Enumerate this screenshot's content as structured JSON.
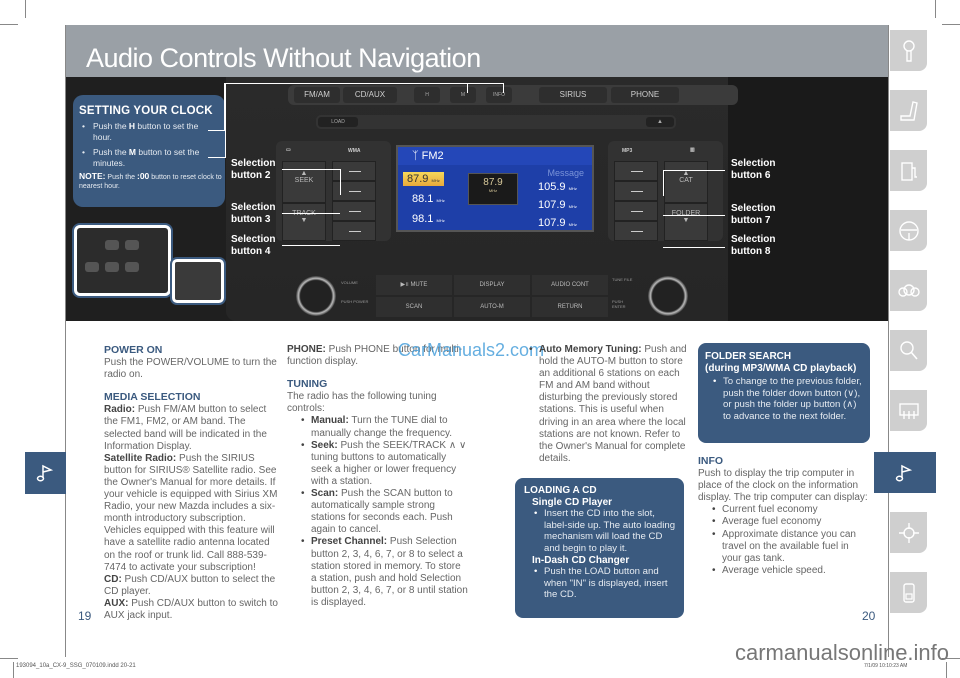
{
  "header": {
    "title": "Audio Controls Without Navigation"
  },
  "radio": {
    "top_buttons": [
      "FM/AM",
      "CD/AUX",
      "H",
      "M",
      "INFO",
      "SIRIUS",
      "PHONE"
    ],
    "load_label": "LOAD",
    "eject_label": "▲",
    "left_panel_labels": [
      "WMA"
    ],
    "right_panel_labels": [
      "MP3"
    ],
    "seek_label": "SEEK",
    "track_label": "TRACK",
    "cat_label": "CAT",
    "folder_label": "FOLDER",
    "screen": {
      "band": "FM2",
      "left_presets": [
        "87.9",
        "88.1",
        "98.1"
      ],
      "unit": "MHz",
      "current": "87.9",
      "current_unit": "MHz",
      "message": "Message",
      "right_presets": [
        "105.9",
        "107.9",
        "107.9"
      ]
    },
    "bottom_buttons": [
      "MUTE",
      "DISPLAY",
      "AUDIO CONT",
      "SCAN",
      "AUTO-M",
      "RETURN"
    ],
    "volume_label": "VOLUME",
    "push_power_label": "PUSH POWER",
    "tune_file_label": "TUNE FILE",
    "push_enter_label": "PUSH ENTER"
  },
  "clock_box": {
    "title": "SETTING YOUR CLOCK",
    "items": [
      {
        "pre": "Push the ",
        "key": "H",
        "post": " button to set the hour."
      },
      {
        "pre": "Push the ",
        "key": "M",
        "post": " button to set the minutes."
      }
    ],
    "note_label": "NOTE:",
    "note_pre": " Push the ",
    "note_key": ":00",
    "note_post": " button to reset clock to nearest hour."
  },
  "callouts": {
    "sel2": [
      "Selection",
      "button 2"
    ],
    "sel3": [
      "Selection",
      "button 3"
    ],
    "sel4": [
      "Selection",
      "button 4"
    ],
    "sel6": [
      "Selection",
      "button 6"
    ],
    "sel7": [
      "Selection",
      "button 7"
    ],
    "sel8": [
      "Selection",
      "button 8"
    ]
  },
  "col1": {
    "power_h": "POWER ON",
    "power_t": "Push the POWER/VOLUME to turn the radio on.",
    "media_h": "MEDIA SELECTION",
    "radio_b": "Radio:",
    "radio_t": " Push FM/AM button to select the FM1, FM2, or AM band. The selected band will be indicated in the Information Display.",
    "sat_b": "Satellite Radio:",
    "sat_t": " Push the SIRIUS button for SIRIUS® Satellite radio. See the Owner's Manual for more details. If your vehicle is equipped with Sirius XM Radio, your new Mazda includes a six-month introductory subscription. Vehicles equipped with this feature will have a satellite radio antenna located on the roof or trunk lid. Call 888-539-7474 to activate your subscription!",
    "cd_b": "CD:",
    "cd_t": " Push CD/AUX button to select the CD player.",
    "aux_b": "AUX:",
    "aux_t": " Push CD/AUX button to switch to AUX jack input."
  },
  "col2": {
    "phone_b": "PHONE:",
    "phone_t": " Push PHONE button for multi-function display.",
    "tuning_h": "TUNING",
    "tuning_t": "The radio has the following tuning controls:",
    "items": [
      {
        "b": "Manual:",
        "t": " Turn the TUNE dial to manually change the frequency."
      },
      {
        "b": "Seek:",
        "t": " Push the SEEK/TRACK ∧ ∨ tuning buttons to automatically seek a higher or lower frequency with a station."
      },
      {
        "b": "Scan:",
        "t": " Push the SCAN button to automatically sample strong stations for seconds each. Push again to cancel."
      },
      {
        "b": "Preset Channel:",
        "t": " Push Selection button 2, 3, 4, 6, 7, or 8 to select a station stored in memory. To store a station, push and hold Selection button 2, 3, 4, 6, 7, or 8 until station is displayed."
      }
    ]
  },
  "col3": {
    "auto_b": "Auto Memory Tuning:",
    "auto_t": " Push and hold the AUTO-M button to store an additional 6 stations on each FM and AM band without disturbing the previously stored stations. This is useful when driving in an area where the local stations are not known. Refer to the Owner's Manual for complete details."
  },
  "loading_box": {
    "title": "LOADING A CD",
    "sub1": "Single CD Player",
    "item1": "Insert the CD into the slot, label-side up. The auto loading mechanism will load the CD and begin to play it.",
    "sub2": "In-Dash CD Changer",
    "item2": "Push the LOAD button and when \"IN\" is displayed, insert the CD."
  },
  "folder_box": {
    "title": "FOLDER SEARCH",
    "subtitle": "(during MP3/WMA CD playback)",
    "item": "To change to the previous folder, push the folder down button (∨), or push the folder up button (∧) to advance to the next folder."
  },
  "info": {
    "title": "INFO",
    "text": "Push to display the trip computer in place of the clock on the information display. The trip computer can display:",
    "items": [
      "Current fuel economy",
      "Average fuel economy",
      "Approximate distance you can travel on the available fuel in your gas tank.",
      "Average vehicle speed."
    ]
  },
  "page_numbers": {
    "left": "19",
    "right": "20"
  },
  "watermark": "CarManuals2.com",
  "footer": {
    "file": "193094_10a_CX-9_SSG_070109.indd   20-21",
    "site": "carmanualsonline.info",
    "date": "7/1/09   10:10:23 AM"
  },
  "side_tabs": [
    "key-icon",
    "seat-icon",
    "fuel-pump-icon",
    "steering-wheel-icon",
    "gauges-icon",
    "search-icon",
    "climate-icon",
    "music-note-icon",
    "navigation-icon",
    "phone-icon"
  ],
  "colors": {
    "accent": "#3b5a7f",
    "header_gray": "#9aa0a6",
    "tab_gray": "#cfcfcf"
  }
}
